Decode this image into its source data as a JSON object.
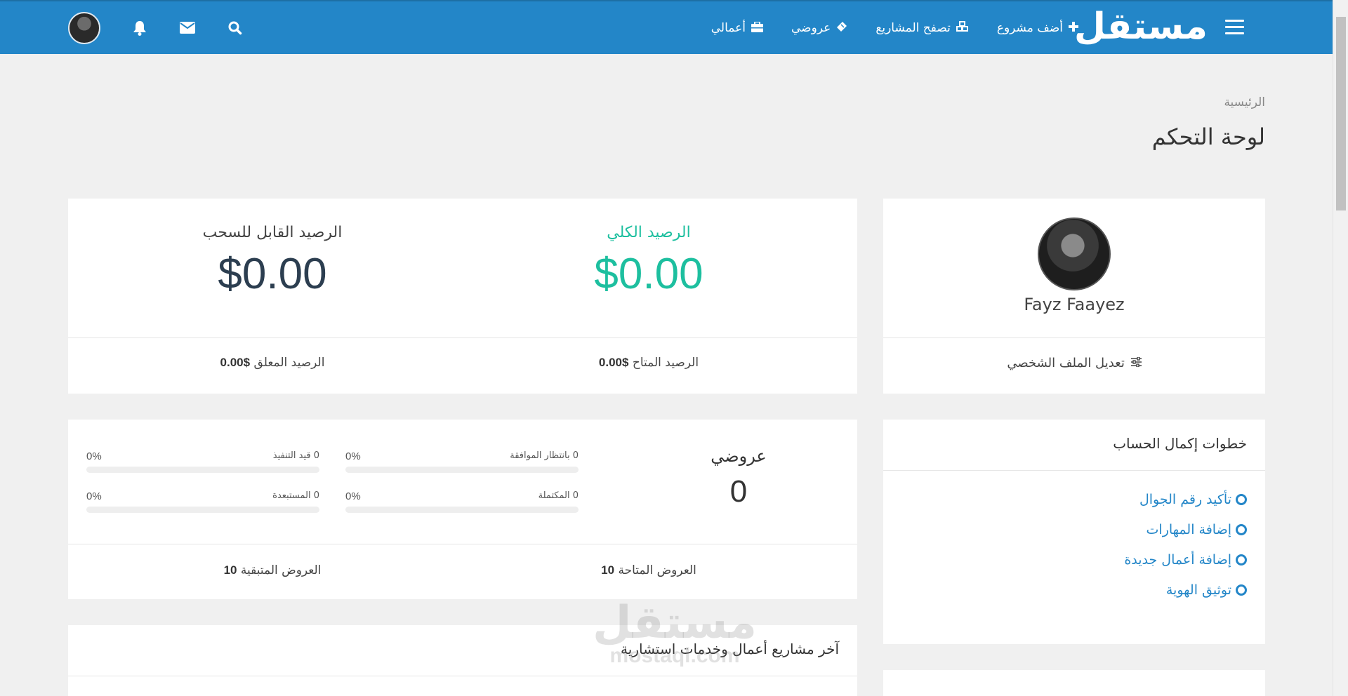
{
  "nav": {
    "logo": "مستقل",
    "links": [
      {
        "label": "أضف مشروع",
        "icon": "plus-icon"
      },
      {
        "label": "تصفح المشاريع",
        "icon": "cubes-icon"
      },
      {
        "label": "عروضي",
        "icon": "ticket-icon"
      },
      {
        "label": "أعمالي",
        "icon": "briefcase-icon"
      }
    ],
    "icons": [
      "search-icon",
      "envelope-icon",
      "bell-icon",
      "avatar"
    ]
  },
  "header": {
    "breadcrumb": "الرئيسية",
    "title": "لوحة التحكم"
  },
  "profile": {
    "name": "Fayz Faayez",
    "edit_label": "تعديل الملف الشخصي"
  },
  "balance": {
    "total_label": "الرصيد الكلي",
    "total_value": "$0.00",
    "withdrawable_label": "الرصيد القابل للسحب",
    "withdrawable_value": "$0.00",
    "available_label": "الرصيد المتاح",
    "available_value": "$0.00",
    "pending_label": "الرصيد المعلق",
    "pending_value": "$0.00",
    "total_color": "#1dbf9f"
  },
  "steps": {
    "title": "خطوات إكمال الحساب",
    "items": [
      "تأكيد رقم الجوال",
      "إضافة المهارات",
      "إضافة أعمال جديدة",
      "توثيق الهوية"
    ]
  },
  "offers": {
    "title": "عروضي",
    "count": "0",
    "stats": [
      {
        "label": "0 بانتظار الموافقة",
        "pct": "0%"
      },
      {
        "label": "0 قيد التنفيذ",
        "pct": "0%"
      },
      {
        "label": "0 المكتملة",
        "pct": "0%"
      },
      {
        "label": "0 المستبعدة",
        "pct": "0%"
      }
    ],
    "available_label": "العروض المتاحة",
    "available_value": "10",
    "remaining_label": "العروض المتبقية",
    "remaining_value": "10"
  },
  "latest": {
    "title": "آخر مشاريع أعمال وخدمات استشارية"
  },
  "watermark": {
    "arabic": "مستقل",
    "latin": "mostaql.com"
  },
  "colors": {
    "brand": "#2386c8",
    "link": "#2386c8",
    "accent_green": "#1dbf9f",
    "dark_value": "#2c3e50"
  }
}
